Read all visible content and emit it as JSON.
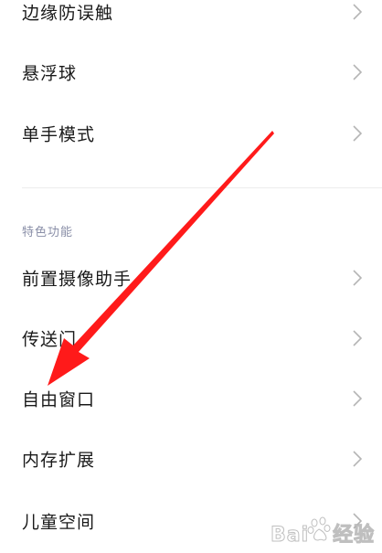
{
  "settings": {
    "items_top": [
      {
        "label": "边缘防误触"
      },
      {
        "label": "悬浮球"
      },
      {
        "label": "单手模式"
      }
    ],
    "section_header": "特色功能",
    "items_bottom": [
      {
        "label": "前置摄像助手"
      },
      {
        "label": "传送门"
      },
      {
        "label": "自由窗口"
      },
      {
        "label": "内存扩展"
      },
      {
        "label": "儿童空间"
      }
    ]
  },
  "icons": {
    "row_chevron": "chevron-right-icon"
  },
  "overlay": {
    "arrow_color": "#ff1a1a"
  },
  "watermark": {
    "brand": "Bai",
    "brand_suffix": "经验"
  }
}
